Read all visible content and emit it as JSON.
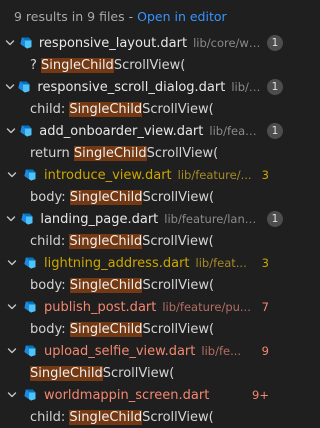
{
  "header": {
    "summary": "9 results in 9 files",
    "separator": "-",
    "open_editor": "Open in editor"
  },
  "colors": {
    "link": "#3794ff",
    "warning": "#cca700",
    "error": "#f48771",
    "highlight": "rgba(234,92,0,0.42)",
    "badge": "#4d4d4d"
  },
  "files": [
    {
      "name": "responsive_layout.dart",
      "path": "lib/core/widg...",
      "count": "1",
      "status": "normal",
      "match": {
        "pre": "? ",
        "hl": "SingleChild",
        "post": "ScrollView("
      }
    },
    {
      "name": "responsive_scroll_dialog.dart",
      "path": "lib/co...",
      "count": "1",
      "status": "normal",
      "match": {
        "pre": "child: ",
        "hl": "SingleChild",
        "post": "ScrollView("
      }
    },
    {
      "name": "add_onboarder_view.dart",
      "path": "lib/featur...",
      "count": "1",
      "status": "normal",
      "match": {
        "pre": "return ",
        "hl": "SingleChild",
        "post": "ScrollView("
      }
    },
    {
      "name": "introduce_view.dart",
      "path": "lib/feature/...",
      "count": "3",
      "status": "warning",
      "match": {
        "pre": "body: ",
        "hl": "SingleChild",
        "post": "ScrollView("
      }
    },
    {
      "name": "landing_page.dart",
      "path": "lib/feature/landin...",
      "count": "1",
      "status": "normal",
      "match": {
        "pre": "child: ",
        "hl": "SingleChild",
        "post": "ScrollView("
      }
    },
    {
      "name": "lightning_address.dart",
      "path": "lib/feat...",
      "count": "3",
      "status": "warning",
      "match": {
        "pre": "body: ",
        "hl": "SingleChild",
        "post": "ScrollView("
      }
    },
    {
      "name": "publish_post.dart",
      "path": "lib/feature/pu...",
      "count": "7",
      "status": "error",
      "match": {
        "pre": "body: ",
        "hl": "SingleChild",
        "post": "ScrollView("
      }
    },
    {
      "name": "upload_selfie_view.dart",
      "path": "lib/fe...",
      "count": "9",
      "status": "error",
      "match": {
        "pre": "",
        "hl": "SingleChild",
        "post": "ScrollView("
      }
    },
    {
      "name": "worldmappin_screen.dart",
      "path": "",
      "count": "9+",
      "status": "error",
      "match": {
        "pre": "child: ",
        "hl": "SingleChild",
        "post": "ScrollView("
      }
    }
  ]
}
